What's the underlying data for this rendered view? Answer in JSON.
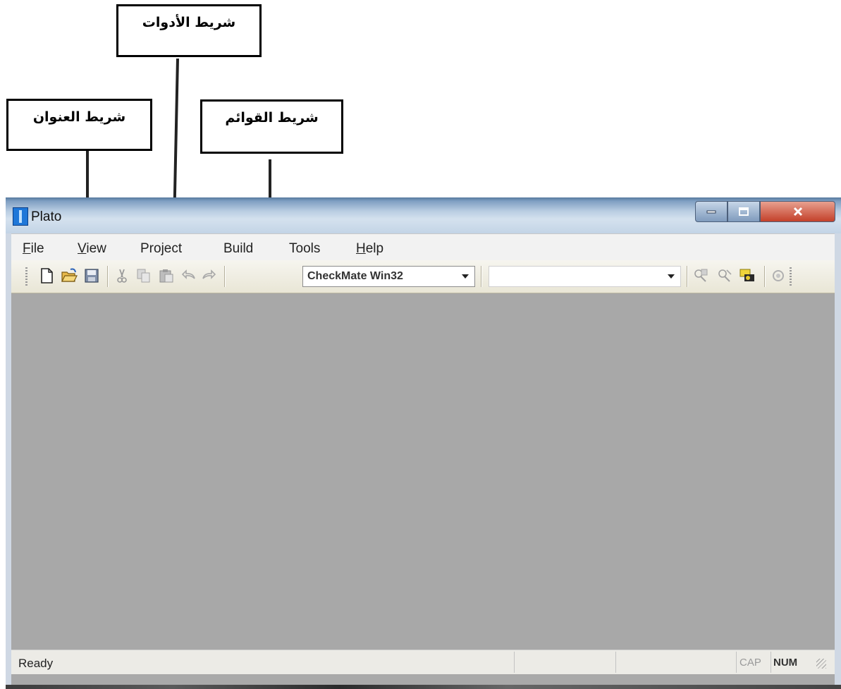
{
  "annotations": {
    "toolbar_label": "شريط الأدوات",
    "title_bar_label": "شريط العنوان",
    "menu_bar_label": "شريط القوائم"
  },
  "window": {
    "title": "Plato",
    "controls": {
      "minimize_icon": "minimize-icon",
      "maximize_icon": "maximize-icon",
      "close_icon": "close-icon"
    }
  },
  "menu": {
    "file": {
      "mnemonic": "F",
      "rest": "ile"
    },
    "view": {
      "mnemonic": "V",
      "rest": "iew"
    },
    "project": "Project",
    "build": "Build",
    "tools": "Tools",
    "help": {
      "mnemonic": "H",
      "rest": "elp"
    }
  },
  "toolbar": {
    "icons": [
      "new-file-icon",
      "open-folder-icon",
      "save-icon",
      "cut-icon",
      "copy-icon",
      "paste-icon",
      "undo-icon",
      "redo-icon",
      "find-icon",
      "find-next-icon",
      "find-in-files-icon",
      "settings-icon"
    ],
    "config_select": {
      "value": "CheckMate Win32"
    },
    "target_select": {
      "value": ""
    }
  },
  "status_bar": {
    "text": "Ready",
    "caps": "CAP",
    "num": "NUM"
  },
  "colors": {
    "title_bar": "#b9cde2",
    "workspace": "#a8a8a8",
    "close_button": "#c3402a"
  }
}
